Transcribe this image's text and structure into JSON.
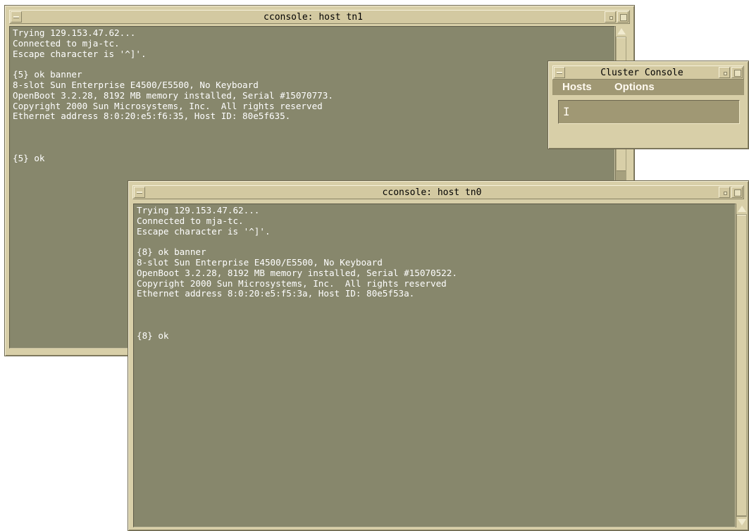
{
  "windows": {
    "tn1": {
      "title": "cconsole: host tn1",
      "lines": [
        "Trying 129.153.47.62...",
        "Connected to mja-tc.",
        "Escape character is '^]'.",
        "",
        "{5} ok banner",
        "8-slot Sun Enterprise E4500/E5500, No Keyboard",
        "OpenBoot 3.2.28, 8192 MB memory installed, Serial #15070773.",
        "Copyright 2000 Sun Microsystems, Inc.  All rights reserved",
        "Ethernet address 8:0:20:e5:f6:35, Host ID: 80e5f635.",
        "",
        "",
        "",
        "{5} ok"
      ]
    },
    "tn0": {
      "title": "cconsole: host tn0",
      "lines": [
        "Trying 129.153.47.62...",
        "Connected to mja-tc.",
        "Escape character is '^]'.",
        "",
        "{8} ok banner",
        "8-slot Sun Enterprise E4500/E5500, No Keyboard",
        "OpenBoot 3.2.28, 8192 MB memory installed, Serial #15070522.",
        "Copyright 2000 Sun Microsystems, Inc.  All rights reserved",
        "Ethernet address 8:0:20:e5:f5:3a, Host ID: 80e5f53a.",
        "",
        "",
        "",
        "{8} ok"
      ]
    },
    "cluster": {
      "title": "Cluster Console",
      "menu": {
        "hosts": "Hosts",
        "options": "Options"
      },
      "cursor": "I"
    }
  },
  "colors": {
    "frame": "#d8cfa8",
    "terminal_bg": "#87876c",
    "terminal_text": "#ffffff"
  }
}
